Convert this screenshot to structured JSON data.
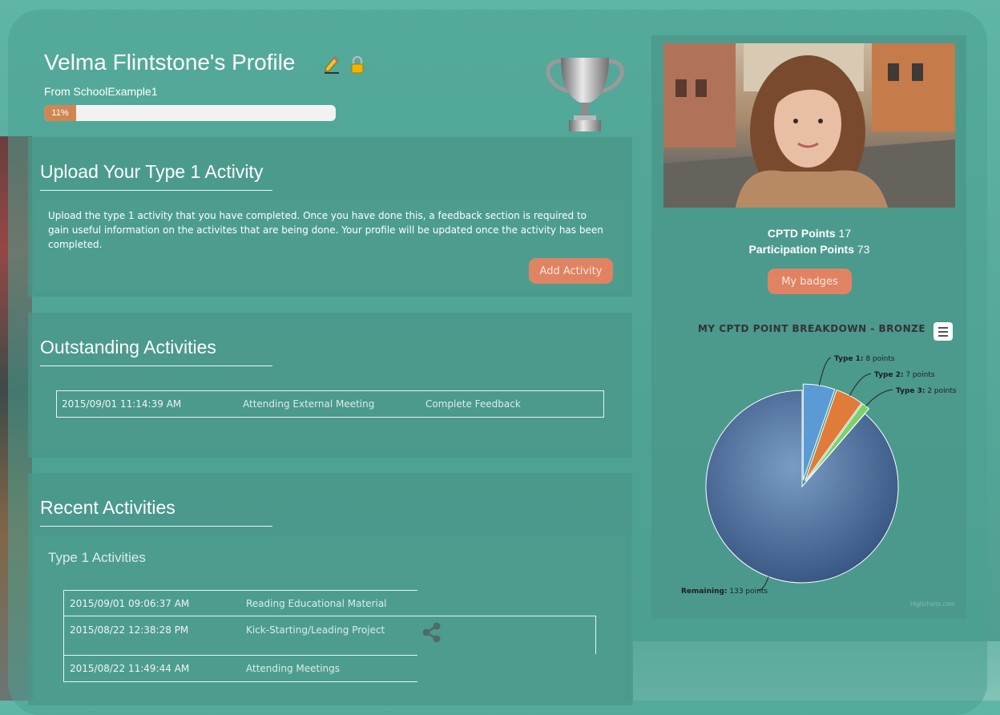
{
  "profile": {
    "title": "Velma Flintstone's Profile",
    "school": "From SchoolExample1",
    "progress_label": "11%",
    "progress_value": 11
  },
  "upload": {
    "heading": "Upload Your Type 1 Activity",
    "description": "Upload the type 1 activity that you have completed. Once you have done this, a feedback section is required to gain useful information on the activites that are being done. Your profile will be updated once the activity has been completed.",
    "button": "Add Activity"
  },
  "outstanding": {
    "heading": "Outstanding Activities",
    "rows": [
      {
        "date": "2015/09/01 11:14:39 AM",
        "activity": "Attending External Meeting",
        "action": "Complete Feedback"
      }
    ]
  },
  "recent": {
    "heading": "Recent Activities",
    "subheading": "Type 1 Activities",
    "rows": [
      {
        "date": "2015/09/01 09:06:37 AM",
        "activity": "Reading Educational Material"
      },
      {
        "date": "2015/08/22 12:38:28 PM",
        "activity": "Kick-Starting/Leading Project"
      },
      {
        "date": "2015/08/22 11:49:44 AM",
        "activity": "Attending Meetings"
      }
    ]
  },
  "points": {
    "cptd_label": "CPTD Points",
    "cptd_value": "17",
    "participation_label": "Participation Points",
    "participation_value": "73"
  },
  "badges_button": "My badges",
  "chart_data": {
    "type": "pie",
    "title": "MY CPTD POINT BREAKDOWN - BRONZE",
    "slices": [
      {
        "name": "Type 1",
        "value": 8,
        "label": "8 points",
        "color": "#5b9bd5"
      },
      {
        "name": "Type 2",
        "value": 7,
        "label": "7 points",
        "color": "#e07b39"
      },
      {
        "name": "Type 3",
        "value": 2,
        "label": "2 points",
        "color": "#7bd26b"
      },
      {
        "name": "Remaining",
        "value": 133,
        "label": "133 points",
        "color": "#3f6796"
      }
    ],
    "credits": "Highcharts.com"
  }
}
